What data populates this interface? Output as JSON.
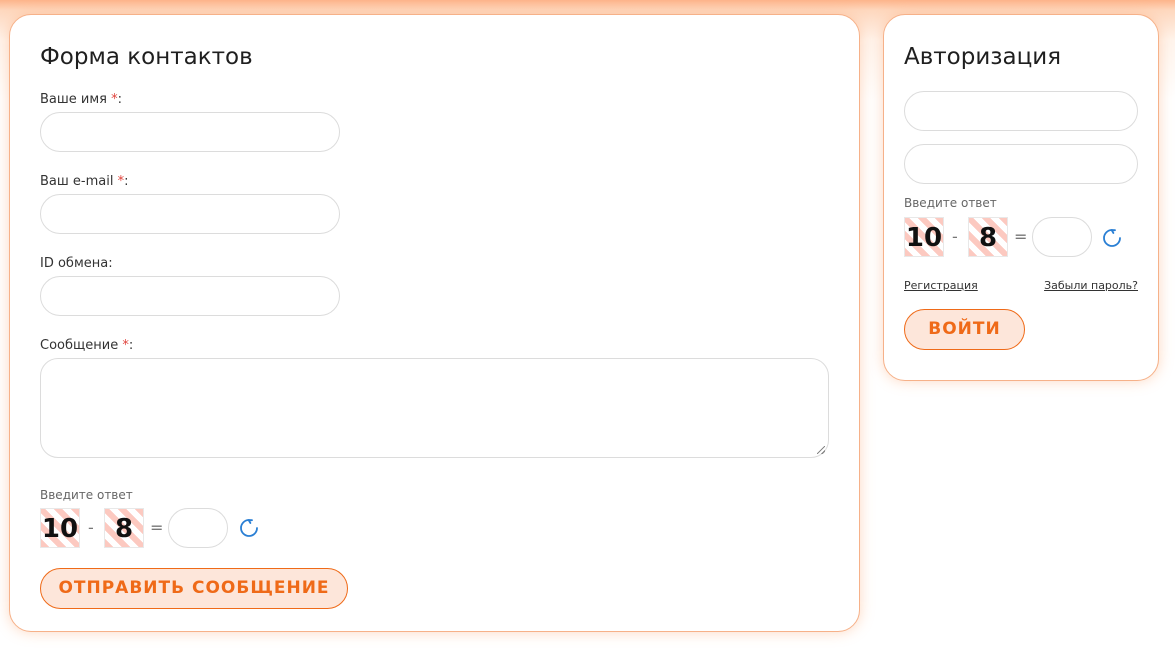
{
  "contact_form": {
    "title": "Форма контактов",
    "name_label": "Ваше имя ",
    "email_label": "Ваш e-mail ",
    "exchange_id_label": "ID обмена:",
    "message_label": "Сообщение ",
    "required_mark": "*",
    "colon": ":",
    "captcha": {
      "hint": "Введите ответ",
      "num1": "10",
      "operator": "-",
      "num2": "8",
      "equals": "="
    },
    "submit_label": "ОТПРАВИТЬ СООБЩЕНИЕ"
  },
  "auth_form": {
    "title": "Авторизация",
    "captcha": {
      "hint": "Введите ответ",
      "num1": "10",
      "operator": "-",
      "num2": "8",
      "equals": "="
    },
    "register_link": "Регистрация",
    "forgot_link": "Забыли пароль?",
    "login_label": "ВОЙТИ"
  },
  "icons": {
    "refresh": "refresh-icon"
  },
  "colors": {
    "accent": "#ef6a18",
    "button_bg": "#fde6da",
    "required": "#e0433c",
    "card_border": "#f6b189",
    "captcha_stripe": "#fcc9c0",
    "refresh_icon": "#2a7fd4"
  }
}
